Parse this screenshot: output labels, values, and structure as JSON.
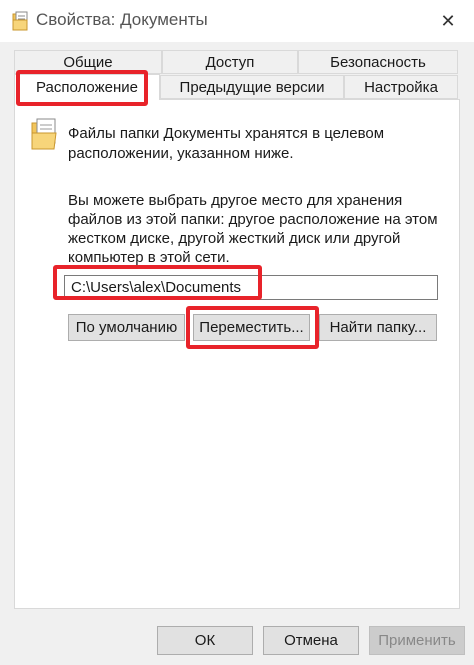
{
  "window": {
    "title": "Свойства: Документы",
    "close_glyph": "✕"
  },
  "tabs": {
    "row1": [
      "Общие",
      "Доступ",
      "Безопасность"
    ],
    "row2": [
      "Расположение",
      "Предыдущие версии",
      "Настройка"
    ],
    "active": "Расположение"
  },
  "panel": {
    "info_line1": "Файлы папки Документы хранятся в целевом",
    "info_line2": "расположении, указанном ниже.",
    "hint_line1": "Вы можете выбрать другое место для хранения",
    "hint_line2": "файлов из этой папки: другое расположение на этом",
    "hint_line3": "жестком диске, другой жесткий диск или другой",
    "hint_line4": "компьютер в этой сети.",
    "path_value": "C:\\Users\\alex\\Documents",
    "restore_default_label": "По умолчанию",
    "move_label": "Переместить...",
    "find_folder_label": "Найти папку..."
  },
  "footer": {
    "ok_label": "ОК",
    "cancel_label": "Отмена",
    "apply_label": "Применить"
  },
  "icons": {
    "title": "folder-document-icon",
    "folder": "folder-document-icon",
    "close": "close-icon"
  },
  "colors": {
    "highlight": "#e8232a",
    "folder": "#f2c55c"
  }
}
